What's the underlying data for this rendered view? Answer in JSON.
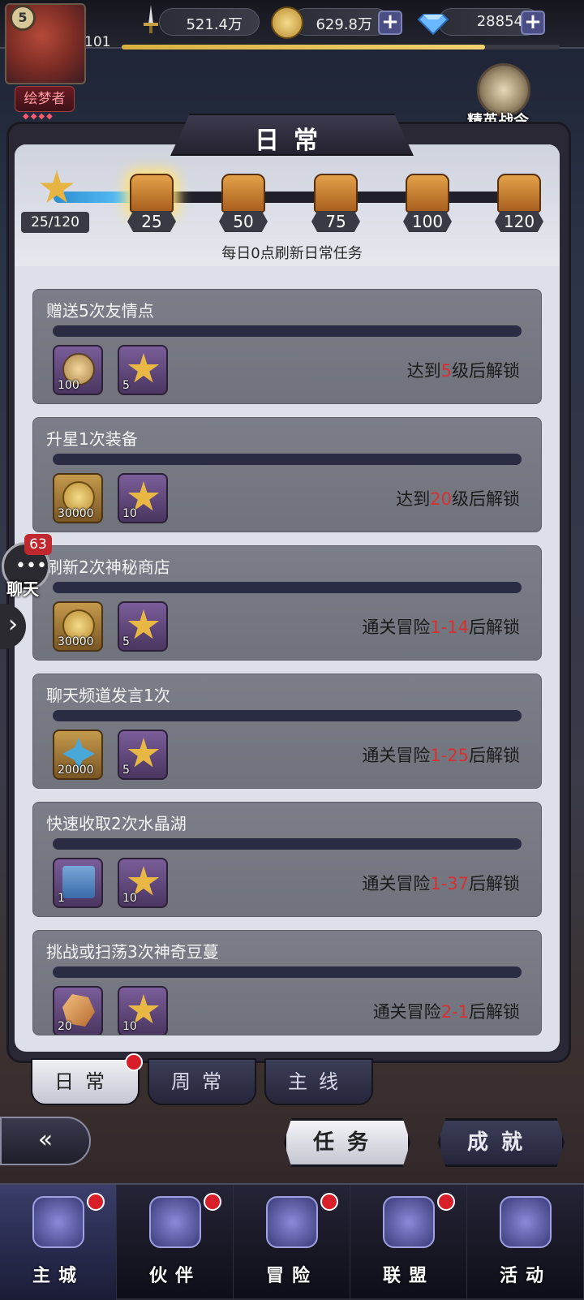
{
  "player": {
    "level": "5",
    "exp_level_text": "101",
    "title_badge": "绘梦者"
  },
  "resources": {
    "power": "521.4万",
    "gold": "629.8万",
    "diamond": "28854"
  },
  "elite_pass_label": "精英战令",
  "panel_title": "日常",
  "activity": {
    "current_text": "25/120",
    "milestones": [
      "25",
      "50",
      "75",
      "100",
      "120"
    ],
    "refresh_note": "每日0点刷新日常任务"
  },
  "tasks": [
    {
      "name": "赠送5次友情点",
      "rewards": [
        "100",
        "5"
      ],
      "lock_pre": "达到",
      "lock_hl": "5",
      "lock_post": "级后解锁"
    },
    {
      "name": "升星1次装备",
      "rewards": [
        "30000",
        "10"
      ],
      "lock_pre": "达到",
      "lock_hl": "20",
      "lock_post": "级后解锁"
    },
    {
      "name": "刷新2次神秘商店",
      "rewards": [
        "30000",
        "5"
      ],
      "lock_pre": "通关冒险",
      "lock_hl": "1-14",
      "lock_post": "后解锁"
    },
    {
      "name": "聊天频道发言1次",
      "rewards": [
        "20000",
        "5"
      ],
      "lock_pre": "通关冒险",
      "lock_hl": "1-25",
      "lock_post": "后解锁"
    },
    {
      "name": "快速收取2次水晶湖",
      "rewards": [
        "1",
        "10"
      ],
      "lock_pre": "通关冒险",
      "lock_hl": "1-37",
      "lock_post": "后解锁"
    },
    {
      "name": "挑战或扫荡3次神奇豆蔓",
      "rewards": [
        "20",
        "10"
      ],
      "lock_pre": "通关冒险",
      "lock_hl": "2-1",
      "lock_post": "后解锁"
    }
  ],
  "chat": {
    "badge": "63",
    "label": "聊天"
  },
  "subtabs": [
    "日常",
    "周常",
    "主线"
  ],
  "buttons": {
    "task": "任务",
    "achievement": "成就"
  },
  "nav": [
    "主城",
    "伙伴",
    "冒险",
    "联盟",
    "活动"
  ],
  "colors": {
    "accent_red": "#d83030",
    "progress_blue": "#5ec8ff"
  }
}
